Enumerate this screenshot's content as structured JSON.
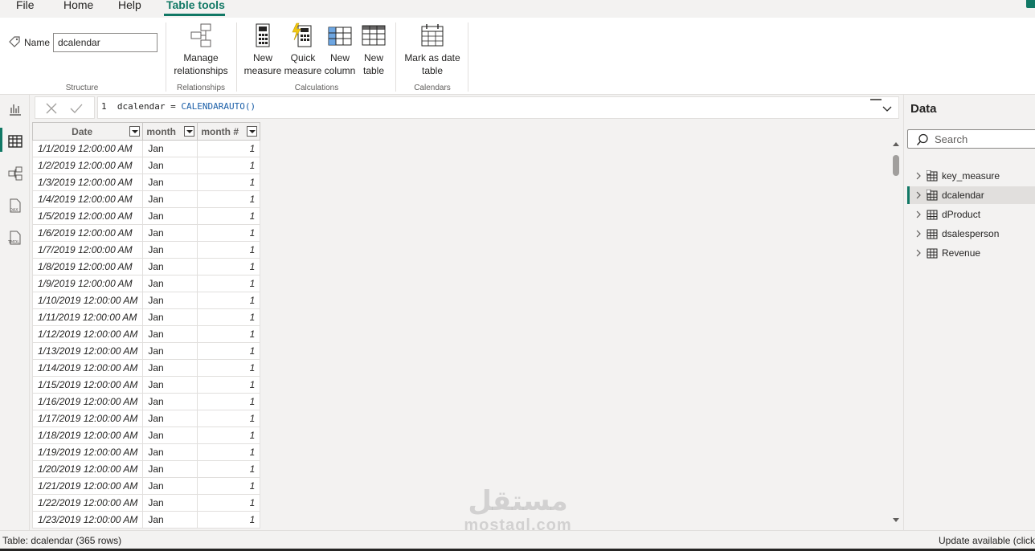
{
  "menu": {
    "items": [
      "File",
      "Home",
      "Help",
      "Table tools"
    ],
    "active": "Table tools"
  },
  "ribbon": {
    "name_label": "Name",
    "name_value": "dcalendar",
    "groups": {
      "structure": "Structure",
      "relationships": "Relationships",
      "calculations": "Calculations",
      "calendars": "Calendars"
    },
    "buttons": {
      "manage_relationships": [
        "Manage",
        "relationships"
      ],
      "new_measure": [
        "New",
        "measure"
      ],
      "quick_measure": [
        "Quick",
        "measure"
      ],
      "new_column": [
        "New",
        "column"
      ],
      "new_table": [
        "New",
        "table"
      ],
      "mark_as_date_table": [
        "Mark as date",
        "table"
      ]
    }
  },
  "formula": {
    "line_number": "1",
    "name": "dcalendar",
    "operator": "=",
    "function": "CALENDARAUTO()"
  },
  "table": {
    "columns": [
      "Date",
      "month",
      "month #"
    ],
    "rows": [
      [
        "1/1/2019 12:00:00 AM",
        "Jan",
        "1"
      ],
      [
        "1/2/2019 12:00:00 AM",
        "Jan",
        "1"
      ],
      [
        "1/3/2019 12:00:00 AM",
        "Jan",
        "1"
      ],
      [
        "1/4/2019 12:00:00 AM",
        "Jan",
        "1"
      ],
      [
        "1/5/2019 12:00:00 AM",
        "Jan",
        "1"
      ],
      [
        "1/6/2019 12:00:00 AM",
        "Jan",
        "1"
      ],
      [
        "1/7/2019 12:00:00 AM",
        "Jan",
        "1"
      ],
      [
        "1/8/2019 12:00:00 AM",
        "Jan",
        "1"
      ],
      [
        "1/9/2019 12:00:00 AM",
        "Jan",
        "1"
      ],
      [
        "1/10/2019 12:00:00 AM",
        "Jan",
        "1"
      ],
      [
        "1/11/2019 12:00:00 AM",
        "Jan",
        "1"
      ],
      [
        "1/12/2019 12:00:00 AM",
        "Jan",
        "1"
      ],
      [
        "1/13/2019 12:00:00 AM",
        "Jan",
        "1"
      ],
      [
        "1/14/2019 12:00:00 AM",
        "Jan",
        "1"
      ],
      [
        "1/15/2019 12:00:00 AM",
        "Jan",
        "1"
      ],
      [
        "1/16/2019 12:00:00 AM",
        "Jan",
        "1"
      ],
      [
        "1/17/2019 12:00:00 AM",
        "Jan",
        "1"
      ],
      [
        "1/18/2019 12:00:00 AM",
        "Jan",
        "1"
      ],
      [
        "1/19/2019 12:00:00 AM",
        "Jan",
        "1"
      ],
      [
        "1/20/2019 12:00:00 AM",
        "Jan",
        "1"
      ],
      [
        "1/21/2019 12:00:00 AM",
        "Jan",
        "1"
      ],
      [
        "1/22/2019 12:00:00 AM",
        "Jan",
        "1"
      ],
      [
        "1/23/2019 12:00:00 AM",
        "Jan",
        "1"
      ]
    ]
  },
  "data_pane": {
    "title": "Data",
    "search_placeholder": "Search",
    "tables": [
      "key_measure",
      "dcalendar",
      "dProduct",
      "dsalesperson",
      "Revenue"
    ],
    "selected": "dcalendar"
  },
  "status": {
    "left": "Table: dcalendar (365 rows)",
    "right": "Update available (click"
  },
  "watermark": {
    "arabic": "مستقل",
    "latin": "mostaql.com"
  },
  "colors": {
    "accent": "#117865",
    "formula_keyword": "#1b5fa8"
  }
}
